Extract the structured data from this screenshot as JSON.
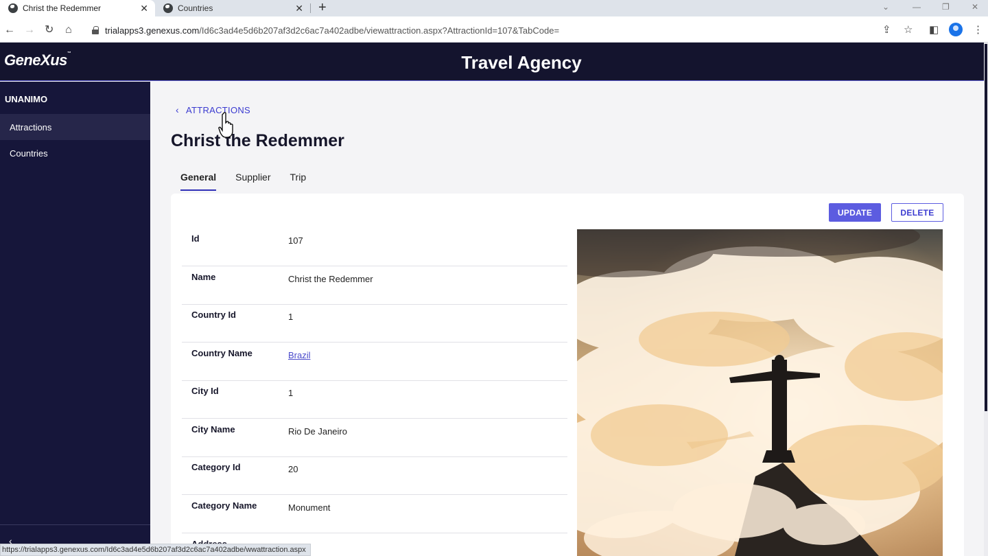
{
  "browser": {
    "tabs": [
      {
        "title": "Christ the Redemmer",
        "active": true
      },
      {
        "title": "Countries",
        "active": false
      }
    ],
    "new_tab": "+",
    "close_glyph": "✕",
    "url_host": "trialapps3.genexus.com",
    "url_path": "/Id6c3ad4e5d6b207af3d2c6ac7a402adbe/viewattraction.aspx?AttractionId=107&TabCode=",
    "status_url": "https://trialapps3.genexus.com/Id6c3ad4e5d6b207af3d2c6ac7a402adbe/wwattraction.aspx"
  },
  "header": {
    "logo": "GeneXus",
    "logo_tm": "™",
    "title": "Travel Agency"
  },
  "sidebar": {
    "section": "UNANIMO",
    "items": [
      {
        "label": "Attractions",
        "active": true
      },
      {
        "label": "Countries",
        "active": false
      }
    ],
    "collapse_glyph": "‹"
  },
  "page": {
    "back_label": "ATTRACTIONS",
    "title": "Christ the Redemmer",
    "tabs": [
      {
        "label": "General",
        "active": true
      },
      {
        "label": "Supplier",
        "active": false
      },
      {
        "label": "Trip",
        "active": false
      }
    ],
    "actions": {
      "update": "UPDATE",
      "delete": "DELETE"
    },
    "fields": [
      {
        "label": "Id",
        "value": "107"
      },
      {
        "label": "Name",
        "value": "Christ the Redemmer"
      },
      {
        "label": "Country Id",
        "value": "1"
      },
      {
        "label": "Country Name",
        "value": "Brazil",
        "link": true
      },
      {
        "label": "City Id",
        "value": "1"
      },
      {
        "label": "City Name",
        "value": "Rio De Janeiro"
      },
      {
        "label": "Category Id",
        "value": "20"
      },
      {
        "label": "Category Name",
        "value": "Monument"
      },
      {
        "label": "Address",
        "value": ""
      }
    ]
  },
  "colors": {
    "header_bg": "#14142e",
    "sidebar_bg": "#16163a",
    "accent": "#5c5ce0",
    "link": "#3b3bd0"
  },
  "icons": [
    "globe-icon",
    "back-arrow-icon",
    "forward-arrow-icon",
    "reload-icon",
    "home-icon",
    "lock-icon",
    "share-icon",
    "star-icon",
    "sidepanel-icon",
    "profile-icon",
    "kebab-menu-icon",
    "chevron-left-icon",
    "hand-cursor-icon"
  ]
}
